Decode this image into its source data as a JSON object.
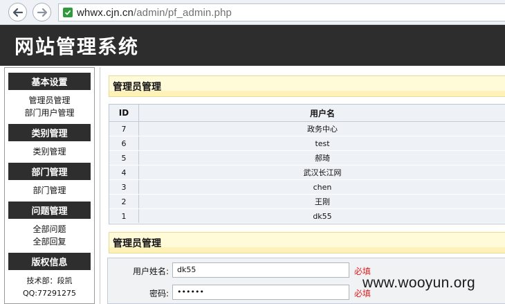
{
  "browser": {
    "url_host": "whwx.cjn.cn",
    "url_path": "/admin/pf_admin.php"
  },
  "header": {
    "title": "网站管理系统"
  },
  "sidebar": {
    "sections": [
      {
        "heading": "基本设置",
        "links": [
          "管理员管理",
          "部门用户管理"
        ]
      },
      {
        "heading": "类别管理",
        "links": [
          "类别管理"
        ]
      },
      {
        "heading": "部门管理",
        "links": [
          "部门管理"
        ]
      },
      {
        "heading": "问题管理",
        "links": [
          "全部问题",
          "全部回复"
        ]
      },
      {
        "heading": "版权信息",
        "info": [
          "技术部：段凯",
          "QQ:77291275"
        ]
      }
    ]
  },
  "main": {
    "list_panel_title": "管理员管理",
    "table": {
      "headers": [
        "ID",
        "用户名"
      ],
      "rows": [
        [
          "7",
          "政务中心"
        ],
        [
          "6",
          "test"
        ],
        [
          "5",
          "郝琦"
        ],
        [
          "4",
          "武汉长江网"
        ],
        [
          "3",
          "chen"
        ],
        [
          "2",
          "王刚"
        ],
        [
          "1",
          "dk55"
        ]
      ]
    },
    "form_panel_title": "管理员管理",
    "form": {
      "username_label": "用户姓名:",
      "username_value": "dk55",
      "password_label": "密码:",
      "password_value": "••••••",
      "required_text": "必填"
    }
  },
  "watermark": "www.wooyun.org"
}
